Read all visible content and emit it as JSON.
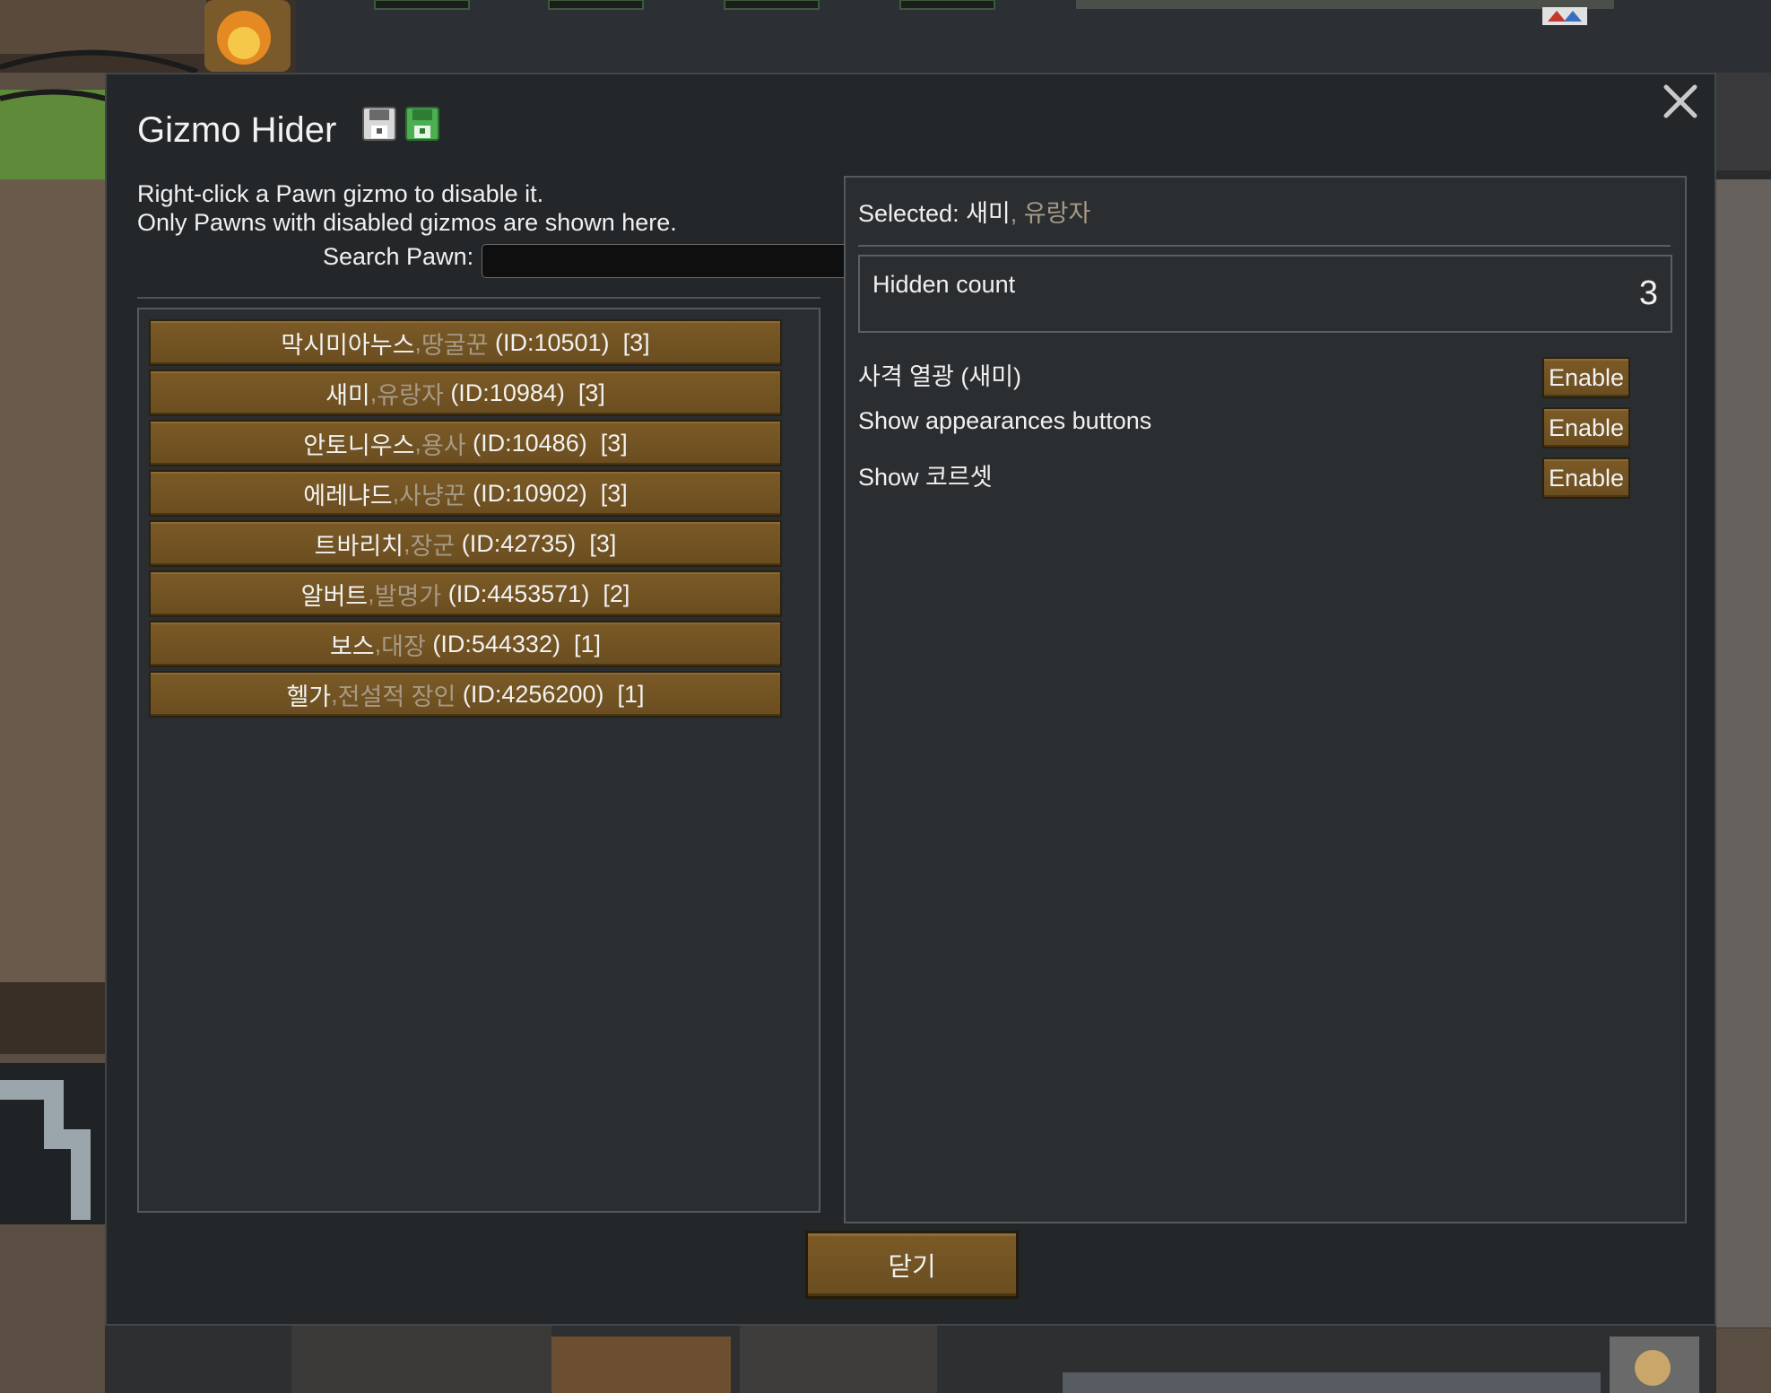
{
  "dialog": {
    "title": "Gizmo Hider",
    "instructions": [
      "Right-click a Pawn gizmo to disable it.",
      "Only Pawns with disabled gizmos are shown here."
    ],
    "search": {
      "label": "Search Pawn:",
      "value": "",
      "placeholder": ""
    },
    "close_label": "닫기"
  },
  "pawns": [
    {
      "name": "막시미아누스",
      "sep": ", ",
      "title": "땅굴꾼",
      "id": "(ID:10501)",
      "count": "[3]"
    },
    {
      "name": "새미",
      "sep": ", ",
      "title": "유랑자",
      "id": "(ID:10984)",
      "count": "[3]"
    },
    {
      "name": "안토니우스",
      "sep": ", ",
      "title": "용사",
      "id": "(ID:10486)",
      "count": "[3]"
    },
    {
      "name": "에레냐드",
      "sep": ", ",
      "title": "사냥꾼",
      "id": "(ID:10902)",
      "count": "[3]"
    },
    {
      "name": "트바리치",
      "sep": ", ",
      "title": "장군",
      "id": "(ID:42735)",
      "count": "[3]"
    },
    {
      "name": "알버트",
      "sep": ", ",
      "title": "발명가",
      "id": "(ID:4453571)",
      "count": "[2]"
    },
    {
      "name": "보스",
      "sep": ", ",
      "title": "대장",
      "id": "(ID:544332)",
      "count": "[1]"
    },
    {
      "name": "헬가",
      "sep": ", ",
      "title": "전설적 장인",
      "id": "(ID:4256200)",
      "count": "[1]"
    }
  ],
  "selected": {
    "prefix": "Selected: ",
    "name": "새미",
    "sep": ", ",
    "title": "유랑자"
  },
  "hidden": {
    "label": "Hidden count",
    "value": "3"
  },
  "gizmos": [
    {
      "label": "사격 열광 (새미)",
      "button": "Enable"
    },
    {
      "label": "Show appearances buttons",
      "button": "Enable"
    },
    {
      "label": "Show 코르셋",
      "button": "Enable"
    }
  ],
  "colors": {
    "button_brown": "#6f5122",
    "dialog_bg": "#23272a",
    "title_gray": "#a79a86"
  }
}
